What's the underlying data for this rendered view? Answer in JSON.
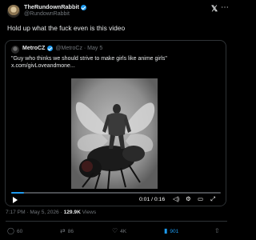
{
  "author": {
    "name": "TheRundownRabbit",
    "handle": "@RundownRabbit"
  },
  "tweet_text": "Hold up what the fuck even is this video",
  "quote": {
    "name": "MetroCZ",
    "handle_date": "@MetroCz · May 5",
    "text_line1": "\"Guy who thinks we should strive to make girls like anime girls\"",
    "text_line2": "x.com/givLoveandmone..."
  },
  "video": {
    "time": "0:01 / 0:16",
    "progress": 0.06,
    "accent": "#1d9bf0"
  },
  "meta": {
    "timestamp": "7:17 PM · May 5, 2026 · ",
    "views_count": "129.9K",
    "views_label": " Views"
  },
  "actions": {
    "replies": "60",
    "reposts": "86",
    "likes": "4K",
    "bookmarks": "901"
  },
  "icons": [
    "x-logo-icon",
    "more-icon",
    "play-icon",
    "volume-icon",
    "settings-icon",
    "fullscreen-icon",
    "reply-icon",
    "repost-icon",
    "like-icon",
    "bookmark-icon",
    "share-icon"
  ]
}
